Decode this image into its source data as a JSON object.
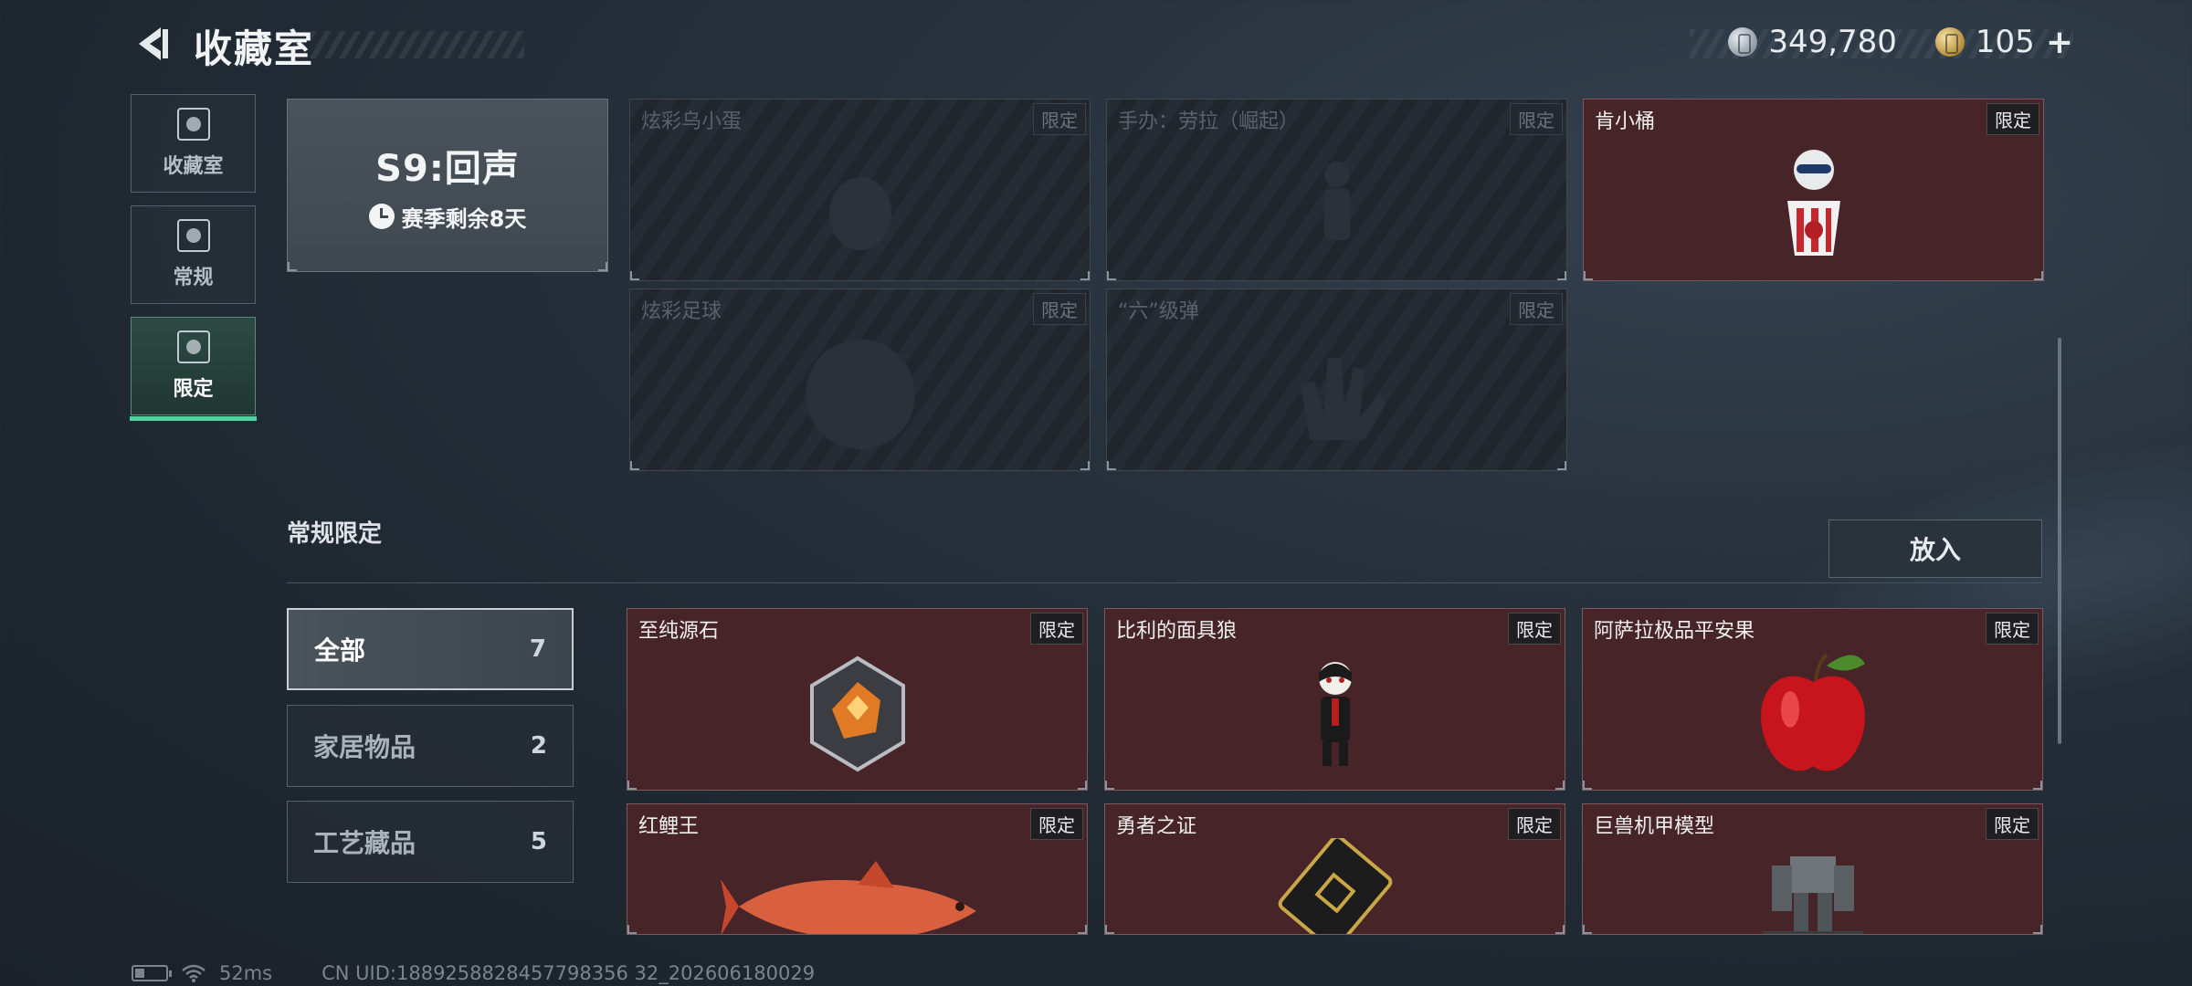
{
  "header": {
    "title": "收藏室",
    "currency_1": "349,780",
    "currency_2": "105",
    "plus": "+"
  },
  "nav": [
    {
      "label": "收藏室",
      "icon": "trophy-icon"
    },
    {
      "label": "常规",
      "icon": "book-icon"
    },
    {
      "label": "限定",
      "icon": "limited-icon"
    }
  ],
  "season": {
    "name": "S9:回声",
    "remaining": "赛季剩余8天"
  },
  "season_items": [
    {
      "name": "炫彩乌小蛋",
      "tag": "限定",
      "state": "locked"
    },
    {
      "name": "手办：劳拉（崛起）",
      "tag": "限定",
      "state": "locked"
    },
    {
      "name": "肯小桶",
      "tag": "限定",
      "state": "owned"
    },
    {
      "name": "炫彩足球",
      "tag": "限定",
      "state": "locked"
    },
    {
      "name": "“六”级弹",
      "tag": "限定",
      "state": "locked"
    }
  ],
  "section": {
    "title": "常规限定",
    "place_button": "放入"
  },
  "filters": [
    {
      "label": "全部",
      "count": "7"
    },
    {
      "label": "家居物品",
      "count": "2"
    },
    {
      "label": "工艺藏品",
      "count": "5"
    }
  ],
  "items": [
    {
      "name": "至纯源石",
      "tag": "限定"
    },
    {
      "name": "比利的面具狼",
      "tag": "限定"
    },
    {
      "name": "阿萨拉极品平安果",
      "tag": "限定"
    },
    {
      "name": "红鲤王",
      "tag": "限定"
    },
    {
      "name": "勇者之证",
      "tag": "限定"
    },
    {
      "name": "巨兽机甲模型",
      "tag": "限定"
    }
  ],
  "footer": {
    "latency": "52ms",
    "uid": "CN UID:1889258828457798356 32_202606180029"
  },
  "colors": {
    "accent": "#4fd1a0",
    "owned_card": "#462428"
  }
}
